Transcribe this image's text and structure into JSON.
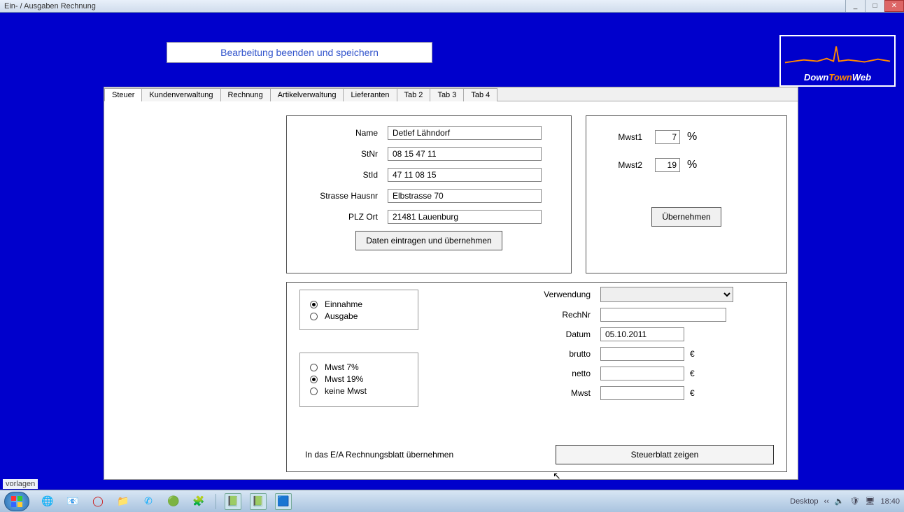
{
  "window": {
    "title": "Ein- / Ausgaben Rechnung"
  },
  "header": {
    "save_button": "Bearbeitung beenden und speichern"
  },
  "logo": {
    "text1": "Down",
    "text2": "Town",
    "text3": "Web"
  },
  "tabs": {
    "items": [
      "Steuer",
      "Kundenverwaltung",
      "Rechnung",
      "Artikelverwaltung",
      "Lieferanten",
      "Tab 2",
      "Tab 3",
      "Tab 4"
    ],
    "active": 0
  },
  "company": {
    "labels": {
      "name": "Name",
      "stnr": "StNr",
      "stid": "StId",
      "strasse": "Strasse Hausnr",
      "plz": "PLZ Ort"
    },
    "values": {
      "name": "Detlef Lähndorf",
      "stnr": "08 15 47 11",
      "stid": "47 11 08 15",
      "strasse": "Elbstrasse 70",
      "plz": "21481 Lauenburg"
    },
    "button": "Daten eintragen und übernehmen"
  },
  "mwst": {
    "labels": {
      "m1": "Mwst1",
      "m2": "Mwst2"
    },
    "values": {
      "m1": "7",
      "m2": "19"
    },
    "pct": "%",
    "button": "Übernehmen"
  },
  "entry": {
    "radio1": {
      "opt1": "Einnahme",
      "opt2": "Ausgabe",
      "selected": 0
    },
    "radio2": {
      "opt1": "Mwst  7%",
      "opt2": "Mwst 19%",
      "opt3": "keine Mwst",
      "selected": 1
    },
    "labels": {
      "verw": "Verwendung",
      "rechnr": "RechNr",
      "datum": "Datum",
      "brutto": "brutto",
      "netto": "netto",
      "mwst": "Mwst"
    },
    "values": {
      "verw": "",
      "rechnr": "",
      "datum": "05.10.2011",
      "brutto": "",
      "netto": "",
      "mwst": ""
    },
    "currency": "€",
    "bottom_label": "In das E/A Rechnungsblatt übernehmen",
    "bottom_button": "Steuerblatt zeigen"
  },
  "footer": {
    "label": "vorlagen"
  },
  "taskbar": {
    "desktop": "Desktop",
    "time": "18:40"
  }
}
